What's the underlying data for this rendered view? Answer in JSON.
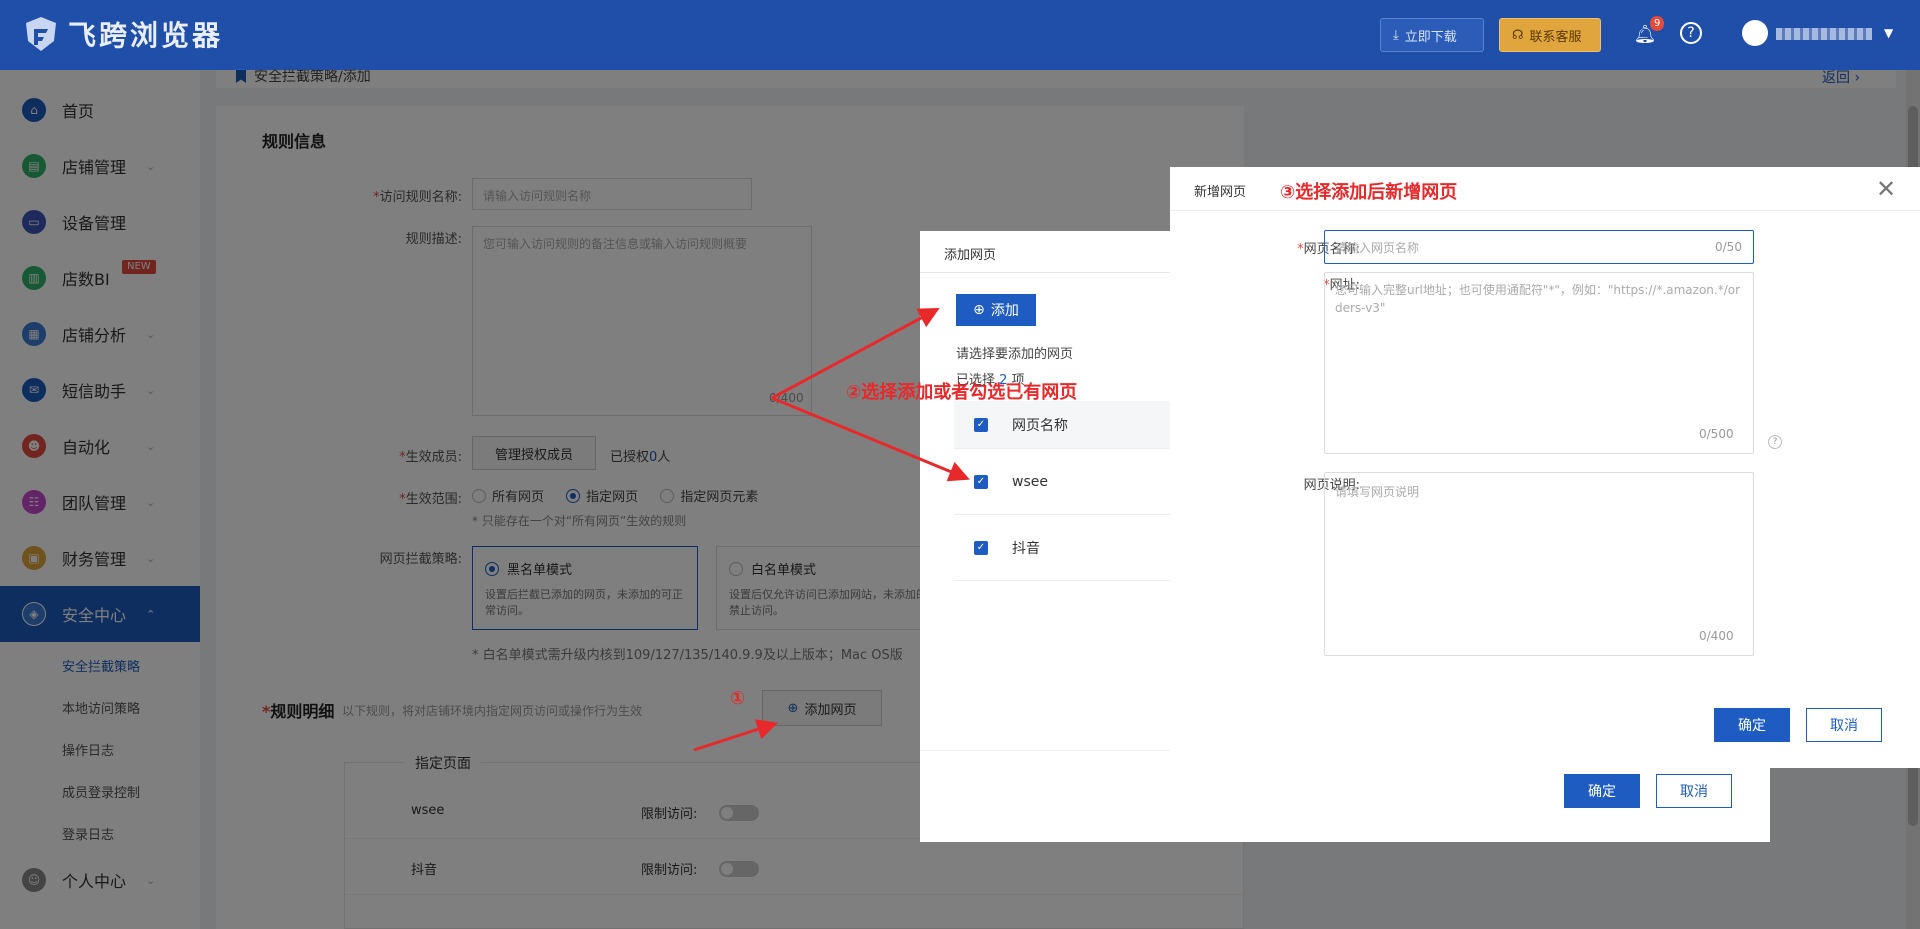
{
  "app": {
    "name": "飞跨浏览器"
  },
  "topbar": {
    "download_label": "立即下载",
    "support_label": "联系客服",
    "notification_count": "9",
    "help_icon": "?"
  },
  "sidebar": {
    "items": [
      {
        "label": "首页",
        "icon": "home-icon",
        "color": "#1f5cc1"
      },
      {
        "label": "店铺管理",
        "icon": "store-icon",
        "color": "#2fb36a"
      },
      {
        "label": "设备管理",
        "icon": "device-icon",
        "color": "#3d52b8"
      },
      {
        "label": "店数BI",
        "icon": "bi-icon",
        "color": "#2fb36a",
        "tag": "NEW"
      },
      {
        "label": "店铺分析",
        "icon": "analysis-icon",
        "color": "#3a7bd5"
      },
      {
        "label": "短信助手",
        "icon": "sms-icon",
        "color": "#1f5cc1"
      },
      {
        "label": "自动化",
        "icon": "robot-icon",
        "color": "#e24b3c"
      },
      {
        "label": "团队管理",
        "icon": "team-icon",
        "color": "#c84bd0"
      },
      {
        "label": "财务管理",
        "icon": "wallet-icon",
        "color": "#e0a53c"
      },
      {
        "label": "安全中心",
        "icon": "shield-icon",
        "color": "#3a7bd5"
      },
      {
        "label": "个人中心",
        "icon": "user-icon",
        "color": "#888888"
      }
    ],
    "sub_items": [
      "安全拦截策略",
      "本地访问策略",
      "操作日志",
      "成员登录控制",
      "登录日志"
    ]
  },
  "breadcrumb": {
    "text": "安全拦截策略/添加",
    "back": "返回"
  },
  "form": {
    "section_rule_info": "规则信息",
    "rule_name_label": "访问规则名称:",
    "rule_name_placeholder": "请输入访问规则名称",
    "rule_desc_label": "规则描述:",
    "rule_desc_placeholder": "您可输入访问规则的备注信息或输入访问规则概要",
    "rule_desc_counter": "0/400",
    "members_label": "生效成员:",
    "members_button": "管理授权成员",
    "members_authorized_prefix": "已授权",
    "members_authorized_count": "0",
    "members_authorized_suffix": "人",
    "scope_label": "生效范围:",
    "scope_options": [
      "所有网页",
      "指定网页",
      "指定网页元素"
    ],
    "scope_note": "* 只能存在一个对“所有网页”生效的规则",
    "strategy_label": "网页拦截策略:",
    "blacklist_title": "黑名单模式",
    "blacklist_desc": "设置后拦截已添加的网页，未添加的可正常访问。",
    "whitelist_title": "白名单模式",
    "whitelist_desc": "设置后仅允许访问已添加网站，未添加的禁止访问。",
    "strategy_note": "* 白名单模式需升级内核到109/127/135/140.9.9及以上版本；Mac OS版",
    "rule_detail_title": "规则明细",
    "rule_detail_hint": "以下规则，将对店铺环境内指定网页访问或操作行为生效",
    "add_page_button": "添加网页",
    "specified_pages_title": "指定页面",
    "pages": [
      {
        "name": "wsee",
        "limit_label": "限制访问:"
      },
      {
        "name": "抖音",
        "limit_label": "限制访问:"
      }
    ]
  },
  "dialog_add_page": {
    "title": "添加网页",
    "add_button": "添加",
    "prompt": "请选择要添加的网页",
    "selected_prefix": "已选择",
    "selected_count": "2",
    "selected_suffix": "项",
    "column_header": "网页名称",
    "rows": [
      "wsee",
      "抖音"
    ],
    "confirm": "确定",
    "cancel": "取消"
  },
  "dialog_new_page": {
    "title": "新增网页",
    "annotation": "③选择添加后新增网页",
    "name_label": "网页名称:",
    "name_placeholder": "请输入网页名称",
    "name_counter": "0/50",
    "url_label": "网址:",
    "url_placeholder": "您可输入完整url地址；也可使用通配符\"*\"，例如：\"https://*.amazon.*/orders-v3\"",
    "url_counter": "0/500",
    "desc_label": "网页说明:",
    "desc_placeholder": "请填写网页说明",
    "desc_counter": "0/400",
    "confirm": "确定",
    "cancel": "取消"
  },
  "annotations": {
    "step1": "①",
    "step2": "②选择添加或者勾选已有网页"
  }
}
